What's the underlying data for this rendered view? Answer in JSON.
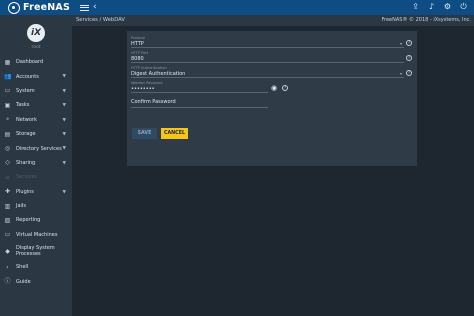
{
  "topbar": {
    "logo_text": "FreeNAS",
    "menu_icon": "menu-icon",
    "back_icon": "chevron-left-icon",
    "right_icons": [
      "upload-icon",
      "bell-icon",
      "gear-icon",
      "power-icon"
    ]
  },
  "brand": {
    "logo_text": "iX",
    "user": "root"
  },
  "sidebar": {
    "items": [
      {
        "label": "Dashboard",
        "icon": "dashboard-icon",
        "glyph": "▦",
        "chevron": false
      },
      {
        "label": "Accounts",
        "icon": "accounts-icon",
        "glyph": "👥",
        "chevron": true
      },
      {
        "label": "System",
        "icon": "system-icon",
        "glyph": "▭",
        "chevron": true
      },
      {
        "label": "Tasks",
        "icon": "calendar-icon",
        "glyph": "▣",
        "chevron": true
      },
      {
        "label": "Network",
        "icon": "network-icon",
        "glyph": "⚬",
        "chevron": true
      },
      {
        "label": "Storage",
        "icon": "storage-icon",
        "glyph": "▤",
        "chevron": true
      },
      {
        "label": "Directory Services",
        "icon": "directory-icon",
        "glyph": "◎",
        "chevron": true
      },
      {
        "label": "Sharing",
        "icon": "sharing-icon",
        "glyph": "◇",
        "chevron": true
      },
      {
        "label": "Services",
        "icon": "services-icon",
        "glyph": "≡",
        "chevron": false,
        "active": true
      },
      {
        "label": "Plugins",
        "icon": "plugins-icon",
        "glyph": "✚",
        "chevron": true
      },
      {
        "label": "Jails",
        "icon": "jails-icon",
        "glyph": "▥",
        "chevron": false
      },
      {
        "label": "Reporting",
        "icon": "reporting-icon",
        "glyph": "▨",
        "chevron": false
      },
      {
        "label": "Virtual Machines",
        "icon": "vm-icon",
        "glyph": "▭",
        "chevron": false
      },
      {
        "label": "Display System Processes",
        "icon": "processes-icon",
        "glyph": "◆",
        "chevron": false,
        "double": true
      },
      {
        "label": "Shell",
        "icon": "shell-icon",
        "glyph": "›",
        "chevron": false
      },
      {
        "label": "Guide",
        "icon": "guide-icon",
        "glyph": "ⓘ",
        "chevron": false
      }
    ]
  },
  "breadcrumb": {
    "text": "Services  /  WebDAV"
  },
  "copyright": "FreeNAS® © 2018 - iXsystems, Inc.",
  "form": {
    "protocol": {
      "label": "Protocol",
      "value": "HTTP"
    },
    "http_port": {
      "label": "HTTP Port",
      "value": "8080"
    },
    "http_auth": {
      "label": "HTTP Authentication",
      "value": "Digest Authentication"
    },
    "password": {
      "label": "Webdav Password",
      "value": "••••••••"
    },
    "confirm_password": {
      "label": "Confirm Password",
      "value": ""
    }
  },
  "buttons": {
    "save": "SAVE",
    "cancel": "CANCEL"
  },
  "colors": {
    "topbar": "#0d4d84",
    "sidebar": "#2b3742",
    "background": "#1e2730",
    "card": "#2f3b46",
    "accent_cancel": "#f5c518"
  }
}
